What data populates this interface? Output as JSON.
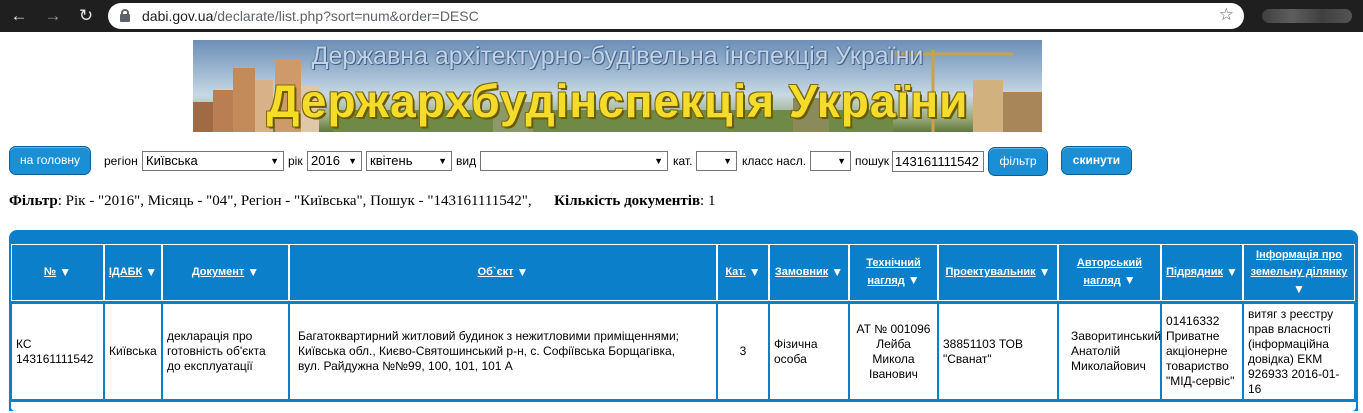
{
  "browser": {
    "url_host": "dabi.gov.ua",
    "url_path": "/declarate/list.php?sort=num&order=DESC"
  },
  "banner": {
    "subtitle": "Державна архітектурно-будівельна інспекція України",
    "title": "Держархбудінспекція України"
  },
  "filters": {
    "home_button": "на головну",
    "region_label": "регіон",
    "region_value": "Київська",
    "year_label": "рік",
    "year_value": "2016",
    "month_value": "квітень",
    "type_label": "вид",
    "type_value": "",
    "cat_label": "кат.",
    "cat_value": "",
    "class_label": "класс насл.",
    "class_value": "",
    "search_label": "пошук",
    "search_value": "143161111542",
    "filter_button": "фільтр",
    "reset_button": "скинути"
  },
  "summary": {
    "filter_label": "Фільтр",
    "filter_text": ": Рік - \"2016\", Місяць - \"04\", Регіон - \"Київська\", Пошук - \"143161111542\",",
    "count_label": "Кількість документів",
    "count_value": ": 1"
  },
  "table": {
    "headers": {
      "num": "№",
      "idabk": "ІДАБК",
      "document": "Документ",
      "object": "Об`єкт",
      "cat": "Кат.",
      "customer": "Замовник",
      "tech_line1": "Технічний",
      "tech_line2": "нагляд",
      "designer": "Проектувальник",
      "author_line1": "Авторський",
      "author_line2": "нагляд",
      "contractor": "Підрядник",
      "land_line1": "Інформація про",
      "land_line2": "земельну ділянку"
    },
    "row": {
      "num_line1": "КС",
      "num_line2": "143161111542",
      "idabk": "Київська",
      "document_line1": "декларація про",
      "document_line2": "готовність об'єкта",
      "document_line3": "до експлуатації",
      "object_line1": "Багатоквартирний житловий будинок з нежитловими приміщеннями;",
      "object_line2": "Київська обл., Києво-Святошинський р-н, с. Софіївська Борщагівка,",
      "object_line3": "вул. Райдужна №№99, 100, 101, 101 А",
      "cat": "3",
      "customer_line1": "Фізична",
      "customer_line2": "особа",
      "tech_line1": "АТ № 001096",
      "tech_line2": "Лейба",
      "tech_line3": "Микола",
      "tech_line4": "Іванович",
      "designer_line1": "38851103 ТОВ",
      "designer_line2": "\"Сванат\"",
      "author_line1": "Заворитинський",
      "author_line2": "Анатолій",
      "author_line3": "Миколайович",
      "contractor_line1": "01416332",
      "contractor_line2": "Приватне",
      "contractor_line3": "акціонерне",
      "contractor_line4": "товариство",
      "contractor_line5": "\"МІД-сервіс\"",
      "land_line1": "витяг з реєстру",
      "land_line2": "прав власності",
      "land_line3": "(інформаційна",
      "land_line4": "довідка) ЕКМ",
      "land_line5": "926933 2016-01-",
      "land_line6": "16"
    }
  }
}
